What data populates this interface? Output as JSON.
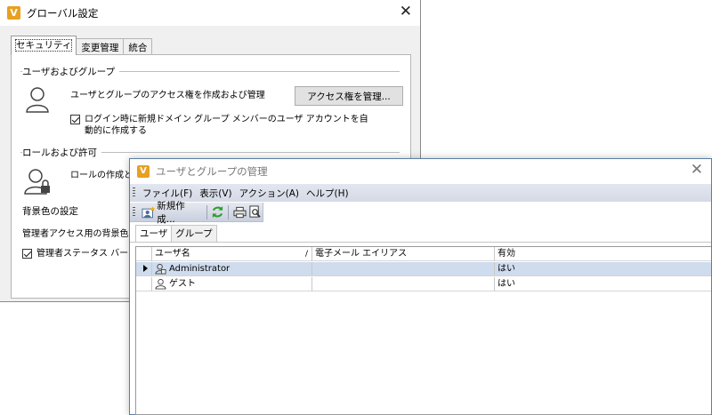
{
  "global_settings": {
    "title": "グローバル設定",
    "tabs": [
      {
        "label": "セキュリティ",
        "active": true
      },
      {
        "label": "変更管理",
        "active": false
      },
      {
        "label": "統合",
        "active": false
      }
    ],
    "users_group": {
      "heading": "ユーザおよびグループ",
      "description": "ユーザとグループのアクセス権を作成および管理",
      "manage_button": "アクセス権を管理...",
      "auto_create_checkbox": {
        "label": "ログイン時に新規ドメイン グループ メンバーのユーザ アカウントを自動的に作成する",
        "checked": true
      }
    },
    "roles_group": {
      "heading": "ロールおよび許可",
      "description": "ロールの作成と管"
    },
    "background_group": {
      "heading": "背景色の設定",
      "description": "管理者アクセス用の背景色を",
      "status_bar_checkbox": {
        "label": "管理者ステータス バーの色",
        "checked": true
      }
    }
  },
  "user_group_manager": {
    "title": "ユーザとグループの管理",
    "menu": [
      "ファイル(F)",
      "表示(V)",
      "アクション(A)",
      "ヘルプ(H)"
    ],
    "toolbar": {
      "new_label": "新規作成..."
    },
    "tabs": [
      {
        "label": "ユーザ",
        "active": true
      },
      {
        "label": "グループ",
        "active": false
      }
    ],
    "table": {
      "columns": [
        "ユーザ名",
        "電子メール エイリアス",
        "有効"
      ],
      "rows": [
        {
          "name": "Administrator",
          "email": "",
          "enabled": "はい",
          "selected": true
        },
        {
          "name": "ゲスト",
          "email": "",
          "enabled": "はい",
          "selected": false
        }
      ]
    }
  },
  "colors": {
    "accent": "#e8a020",
    "selected_row": "#cfdcee",
    "menubar": "#d9dde8"
  },
  "icons": [
    "app-logo-icon",
    "close-icon",
    "person-icon",
    "person-lock-icon",
    "new-user-icon",
    "refresh-icon",
    "print-icon",
    "print-preview-icon",
    "sort-icon",
    "row-pointer-icon"
  ]
}
